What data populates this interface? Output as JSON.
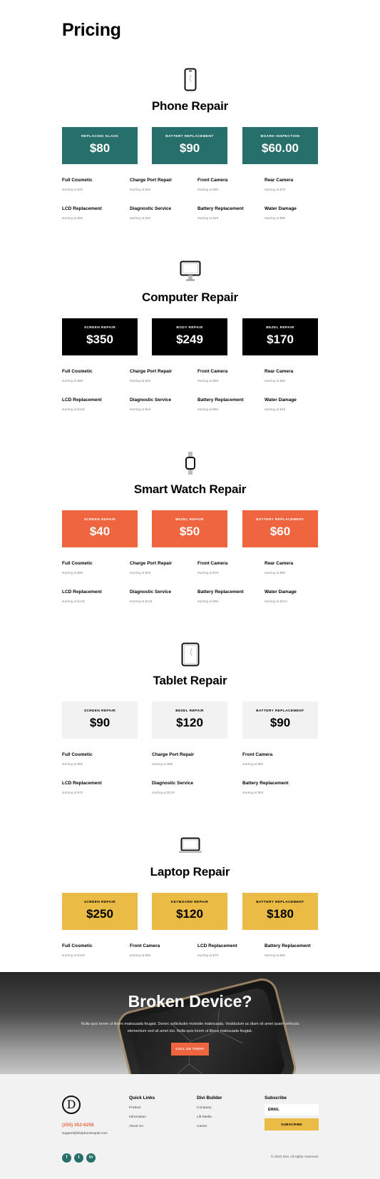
{
  "page": {
    "title": "Pricing"
  },
  "colors": {
    "teal": "#266f6a",
    "black": "#000000",
    "orange": "#ef6540",
    "light": "#f2f2f2",
    "yellow": "#ebbc45"
  },
  "sections": [
    {
      "title": "Phone Repair",
      "icon": "smartphone-icon",
      "cards": [
        {
          "label": "REPLACING GLASS",
          "price": "$80"
        },
        {
          "label": "BATTERY REPLACEMENT",
          "price": "$90"
        },
        {
          "label": "BOARD INSPECTION",
          "price": "$60.00"
        }
      ],
      "services": [
        {
          "name": "Full Cosmetic",
          "price": "starting at $49"
        },
        {
          "name": "Charge Port Repair",
          "price": "starting at $39"
        },
        {
          "name": "Front Camera",
          "price": "starting at $69"
        },
        {
          "name": "Rear Camera",
          "price": "starting at $79"
        },
        {
          "name": "LCD Replacement",
          "price": "starting at $59"
        },
        {
          "name": "Diagnostic Service",
          "price": "starting at $39"
        },
        {
          "name": "Battery Replacement",
          "price": "starting at $49"
        },
        {
          "name": "Water Damage",
          "price": "starting at $99"
        }
      ]
    },
    {
      "title": "Computer Repair",
      "icon": "monitor-icon",
      "cards": [
        {
          "label": "SCREEN REPAIR",
          "price": "$350"
        },
        {
          "label": "BODY REPAIR",
          "price": "$249"
        },
        {
          "label": "BEZEL REPAIR",
          "price": "$170"
        }
      ],
      "services": [
        {
          "name": "Full Cosmetic",
          "price": "starting at $89"
        },
        {
          "name": "Charge Port Repair",
          "price": "starting at $39"
        },
        {
          "name": "Front Camera",
          "price": "starting at $59"
        },
        {
          "name": "Rear Camera",
          "price": "starting at $69"
        },
        {
          "name": "LCD Replacement",
          "price": "starting at $129"
        },
        {
          "name": "Diagnostic Service",
          "price": "starting at $49"
        },
        {
          "name": "Battery Replacement",
          "price": "starting at $59"
        },
        {
          "name": "Water Damage",
          "price": "starting at $49"
        }
      ]
    },
    {
      "title": "Smart Watch Repair",
      "icon": "smartwatch-icon",
      "cards": [
        {
          "label": "SCREEN REPAIR",
          "price": "$40"
        },
        {
          "label": "BEZEL REPAIR",
          "price": "$50"
        },
        {
          "label": "BATTERY REPLACEMENT",
          "price": "$60"
        }
      ],
      "services": [
        {
          "name": "Full Cosmetic",
          "price": "starting at $99"
        },
        {
          "name": "Charge Port Repair",
          "price": "starting at $49"
        },
        {
          "name": "Front Camera",
          "price": "starting at $79"
        },
        {
          "name": "Rear Camera",
          "price": "starting at $89"
        },
        {
          "name": "LCD Replacement",
          "price": "starting at $149"
        },
        {
          "name": "Diagnostic Service",
          "price": "starting at $119"
        },
        {
          "name": "Battery Replacement",
          "price": "starting at $69"
        },
        {
          "name": "Water Damage",
          "price": "starting at $219"
        }
      ]
    },
    {
      "title": "Tablet Repair",
      "icon": "tablet-icon",
      "cards": [
        {
          "label": "SCREEN REPAIR",
          "price": "$90"
        },
        {
          "label": "BEZEL REPAIR",
          "price": "$120"
        },
        {
          "label": "BATTERY REPLACEMENT",
          "price": "$90"
        }
      ],
      "services": [
        {
          "name": "Full Cosmetic",
          "price": "starting at $69"
        },
        {
          "name": "Charge Port Repair",
          "price": "starting at $99"
        },
        {
          "name": "Front Camera",
          "price": "starting at $85"
        },
        {
          "name": "LCD Replacement",
          "price": "starting at $75"
        },
        {
          "name": "Diagnostic Service",
          "price": "starting at $129"
        },
        {
          "name": "Battery Replacement",
          "price": "starting at $59"
        }
      ]
    },
    {
      "title": "Laptop Repair",
      "icon": "laptop-icon",
      "cards": [
        {
          "label": "SCREEN REPAIR",
          "price": "$250"
        },
        {
          "label": "KEYBOARD REPAIR",
          "price": "$120"
        },
        {
          "label": "BATTERY REPLACEMENT",
          "price": "$180"
        }
      ],
      "services": [
        {
          "name": "Full Cosmetic",
          "price": "starting at $129"
        },
        {
          "name": "Front Camera",
          "price": "starting at $99"
        },
        {
          "name": "LCD Replacement",
          "price": "starting at $79"
        },
        {
          "name": "Battery Replacement",
          "price": "starting at $55"
        }
      ]
    }
  ],
  "hero": {
    "title": "Broken Device?",
    "text": "Nulla quis lorem ut libero malesuada feugiat. Donec sollicitudin molestie malesuada. Vestibulum ac diam sit amet quam vehicula elementum sed sit amet dui. Nulla quis lorem ut libero malesuada feugiat.",
    "button": "CALL US TODAY"
  },
  "footer": {
    "logo_letter": "D",
    "phone": "(255) 352-6258",
    "email": "support@diviphonerepair.com",
    "quick_links": {
      "heading": "Quick Links",
      "links": [
        "Product",
        "Information",
        "About Us"
      ]
    },
    "divi_builder": {
      "heading": "Divi Builder",
      "links": [
        "Company",
        "Lift Media",
        "Career"
      ]
    },
    "subscribe": {
      "heading": "Subscribe",
      "input_placeholder": "EMAIL",
      "button": "SUBSCRIBE"
    },
    "social": [
      "f",
      "t",
      "in"
    ],
    "copyright": "© 2022 Divi. All rights reserved."
  }
}
